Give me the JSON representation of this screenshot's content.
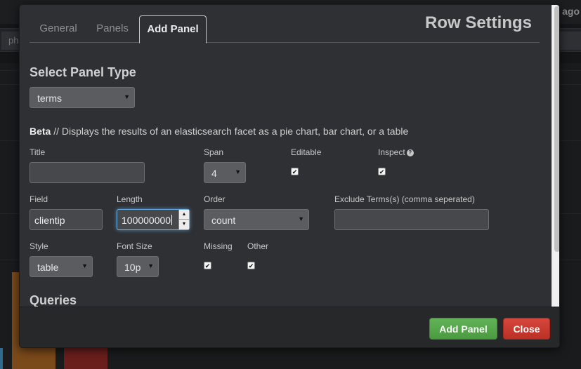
{
  "background": {
    "top_right_text": "ago",
    "search_fragment": "ph"
  },
  "modal": {
    "title": "Row Settings",
    "tabs": [
      {
        "label": "General",
        "active": false
      },
      {
        "label": "Panels",
        "active": false
      },
      {
        "label": "Add Panel",
        "active": true
      }
    ],
    "select_panel_type": {
      "heading": "Select Panel Type",
      "value": "terms"
    },
    "description": {
      "badge": "Beta",
      "text": " // Displays the results of an elasticsearch facet as a pie chart, bar chart, or a table"
    },
    "fields": {
      "title": {
        "label": "Title",
        "value": ""
      },
      "span": {
        "label": "Span",
        "value": "4"
      },
      "editable": {
        "label": "Editable",
        "checked": true
      },
      "inspect": {
        "label": "Inspect",
        "checked": true
      },
      "field": {
        "label": "Field",
        "value": "clientip"
      },
      "length": {
        "label": "Length",
        "value": "100000000"
      },
      "order": {
        "label": "Order",
        "value": "count"
      },
      "exclude": {
        "label": "Exclude Terms(s) (comma seperated)",
        "value": ""
      },
      "style": {
        "label": "Style",
        "value": "table"
      },
      "font_size": {
        "label": "Font Size",
        "value": "10p"
      },
      "missing": {
        "label": "Missing",
        "checked": true
      },
      "other": {
        "label": "Other",
        "checked": true
      }
    },
    "queries_heading": "Queries",
    "footer": {
      "add_label": "Add Panel",
      "close_label": "Close"
    }
  },
  "icons": {
    "caret": "caret-down-icon",
    "check": "check-icon",
    "help": "question-circle-icon",
    "spin_up": "spin-up-icon",
    "spin_down": "spin-down-icon"
  },
  "colors": {
    "modal_bg": "#2f3033",
    "add_button": "#55a64a",
    "close_button": "#c9392f",
    "focus_ring": "#66afe9"
  }
}
